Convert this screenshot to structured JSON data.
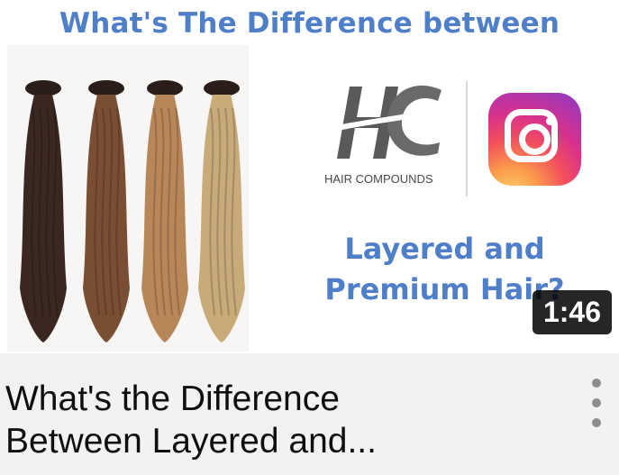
{
  "thumbnail": {
    "heading": "What's The Difference between",
    "subheading_line1": "Layered and",
    "subheading_line2": "Premium Hair?",
    "logo_text": "HAIR COMPOUNDS",
    "duration": "1:46",
    "hair_colors": [
      "#3a2720",
      "#7a4e33",
      "#b7875a",
      "#c9ab7a"
    ],
    "accent_color": "#4f7fc8"
  },
  "video": {
    "title": "What's the Difference\nBetween Layered and..."
  },
  "icons": {
    "more": "more-vert-icon",
    "instagram": "instagram-icon",
    "brand": "hc-logo-icon"
  }
}
